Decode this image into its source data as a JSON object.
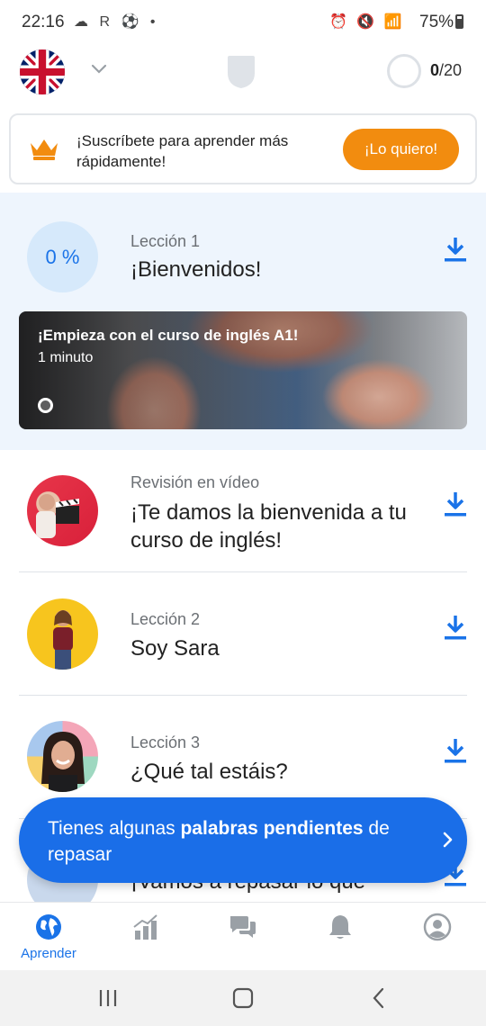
{
  "status_bar": {
    "time": "22:16",
    "left_icons": "☁ R ⚽ •",
    "right_icons": "⏰ 🔇 📶",
    "battery": "75%"
  },
  "app_bar": {
    "language_flag": "uk-flag-icon",
    "goal_current": "0",
    "goal_total": "/20"
  },
  "promo": {
    "text": "¡Suscríbete para aprender más rápidamente!",
    "button_label": "¡Lo quiero!"
  },
  "lessons": [
    {
      "progress": "0 %",
      "eyebrow": "Lección 1",
      "title": "¡Bienvenidos!",
      "video": {
        "title": "¡Empieza con el curso de inglés A1!",
        "duration": "1 minuto"
      }
    },
    {
      "eyebrow": "Revisión en vídeo",
      "title": "¡Te damos la bienvenida a tu curso de inglés!"
    },
    {
      "eyebrow": "Lección 2",
      "title": "Soy Sara"
    },
    {
      "eyebrow": "Lección 3",
      "title": "¿Qué tal estáis?"
    },
    {
      "title": "¡Vamos a repasar lo que"
    }
  ],
  "toast": {
    "text_prefix": "Tienes algunas ",
    "text_bold": "palabras pendientes",
    "text_suffix": " de repasar"
  },
  "bottom_nav": {
    "items": [
      {
        "label": "Aprender",
        "icon": "globe-icon",
        "active": true
      },
      {
        "label": "",
        "icon": "stats-icon"
      },
      {
        "label": "",
        "icon": "chat-icon"
      },
      {
        "label": "",
        "icon": "bell-icon"
      },
      {
        "label": "",
        "icon": "profile-icon"
      }
    ]
  },
  "colors": {
    "accent_blue": "#1a73e8",
    "orange": "#f28c0f",
    "hero_bg": "#eef5fd"
  }
}
